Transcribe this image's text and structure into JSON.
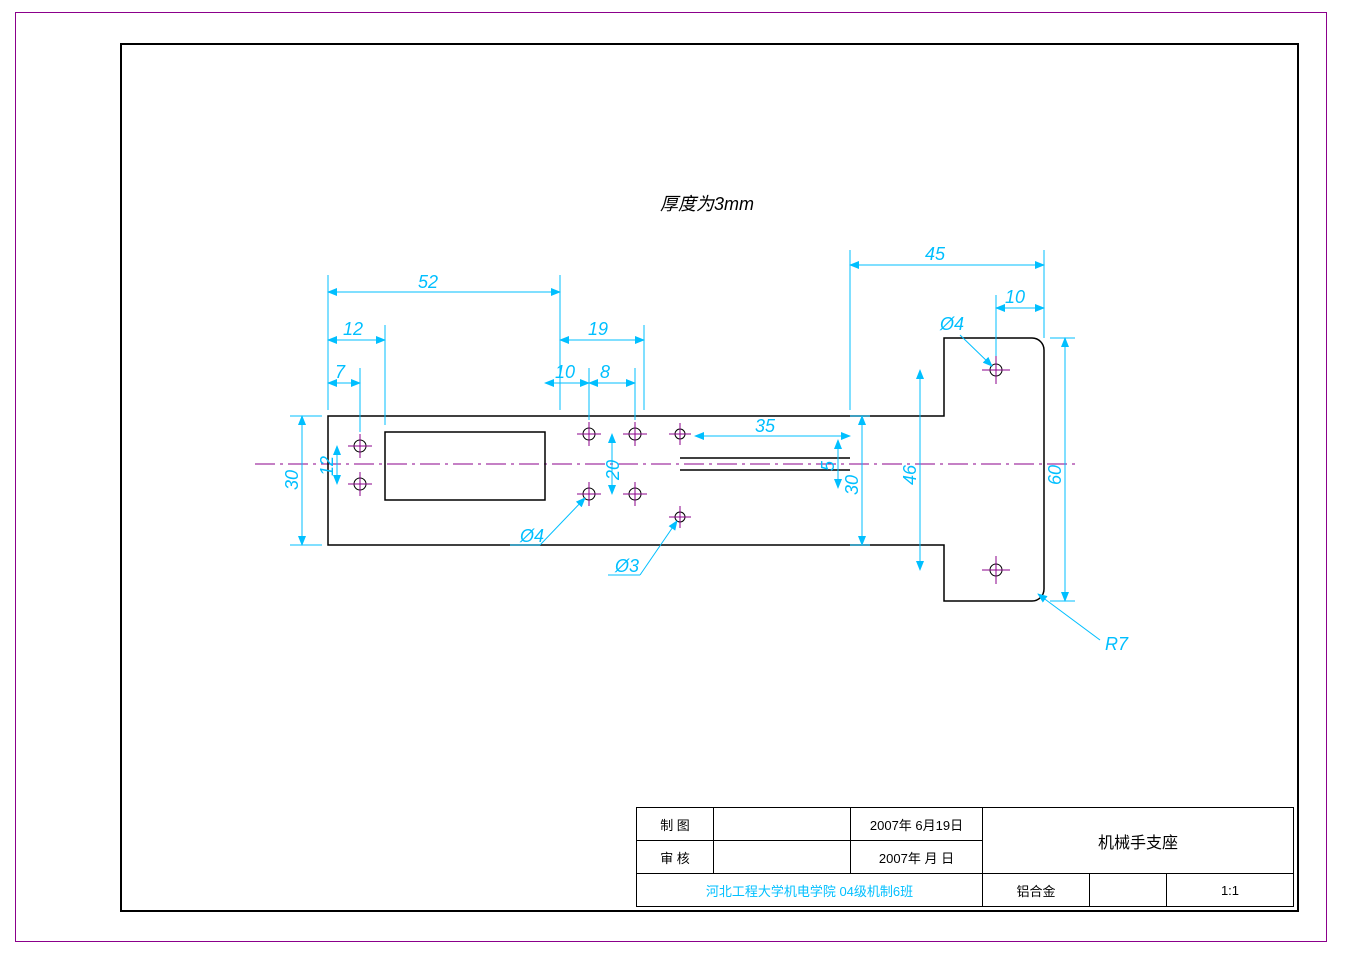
{
  "note": "厚度为3mm",
  "dims": {
    "d52": "52",
    "d45": "45",
    "d10r": "10",
    "d12": "12",
    "d19": "19",
    "d7": "7",
    "d10m": "10",
    "d8": "8",
    "d35": "35",
    "d30l": "30",
    "d12v": "12",
    "d20": "20",
    "d5": "5",
    "d30r": "30",
    "d46": "46",
    "d60": "60",
    "phi4_l": "Ø4",
    "phi4_m": "Ø4",
    "phi3": "Ø3",
    "r7": "R7"
  },
  "titleblock": {
    "r1c1": "制 图",
    "r1c2": "",
    "r1c3": "2007年 6月19日",
    "r2c1": "审 核",
    "r2c2": "",
    "r2c3": "2007年   月   日",
    "r3": "河北工程大学机电学院   04级机制6班",
    "title": "机械手支座",
    "material": "铝合金",
    "blank": "",
    "scale": "1:1"
  }
}
